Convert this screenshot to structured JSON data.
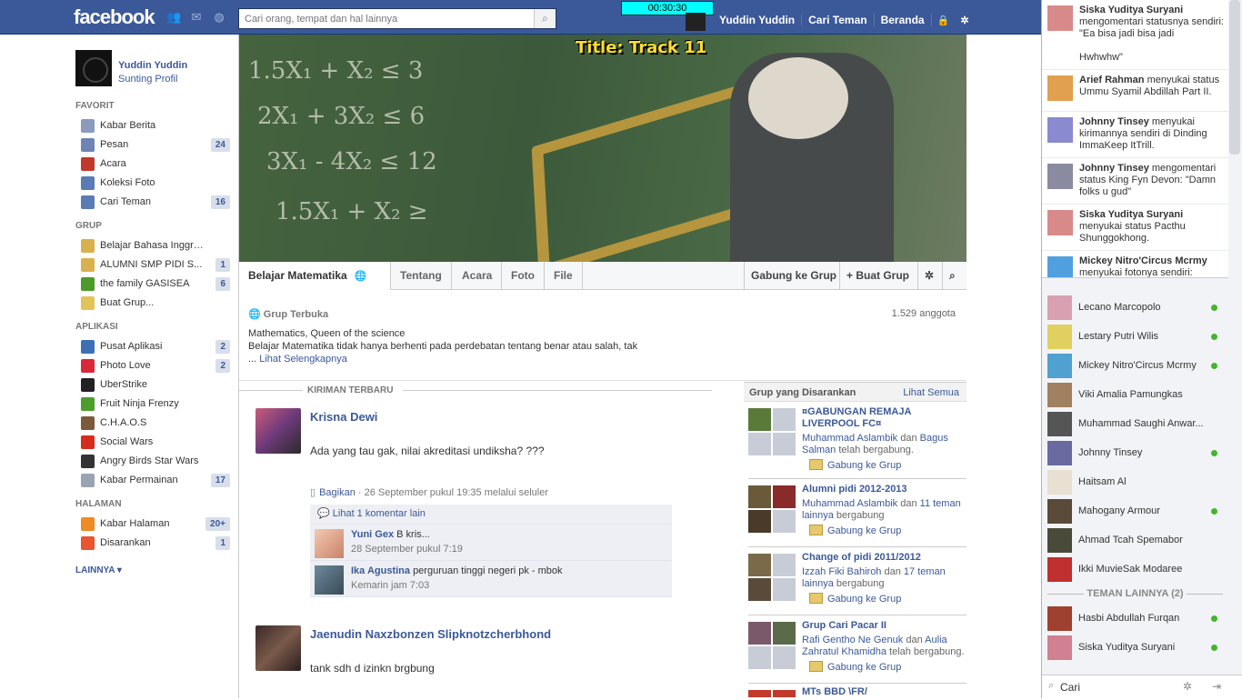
{
  "app": {
    "logo": "facebook",
    "search_placeholder": "Cari orang, tempat dan hal lainnya",
    "timer": "00:30:30"
  },
  "top": {
    "user": "Yuddin Yuddin",
    "find_friends": "Cari Teman",
    "home": "Beranda"
  },
  "profile": {
    "name": "Yuddin Yuddin",
    "edit": "Sunting Profil"
  },
  "nav": {
    "favorites_head": "FAVORIT",
    "favorites": [
      {
        "label": "Kabar Berita",
        "count": "",
        "icon": "news-feed-icon",
        "color": "#8a9bbd"
      },
      {
        "label": "Pesan",
        "count": "24",
        "icon": "messages-icon",
        "color": "#6d84b4"
      },
      {
        "label": "Acara",
        "count": "",
        "icon": "calendar-icon",
        "color": "#c0392b"
      },
      {
        "label": "Koleksi Foto",
        "count": "",
        "icon": "photos-icon",
        "color": "#5b7bb5"
      },
      {
        "label": "Cari Teman",
        "count": "16",
        "icon": "friends-icon",
        "color": "#5b7bb5"
      }
    ],
    "groups_head": "GRUP",
    "groups": [
      {
        "label": "Belajar Bahasa Inggris Bare...",
        "count": "",
        "icon": "group-icon",
        "color": "#d8b14c"
      },
      {
        "label": "ALUMNI SMP PIDI S...",
        "count": "1",
        "icon": "group-icon",
        "color": "#d8b14c"
      },
      {
        "label": "the family GASISEA",
        "count": "6",
        "icon": "tree-icon",
        "color": "#4c9a2a"
      },
      {
        "label": "Buat Grup...",
        "count": "",
        "icon": "create-group-icon",
        "color": "#e2c35a"
      }
    ],
    "apps_head": "APLIKASI",
    "apps": [
      {
        "label": "Pusat Aplikasi",
        "count": "2",
        "icon": "app-center-icon",
        "color": "#3d6fb6"
      },
      {
        "label": "Photo Love",
        "count": "2",
        "icon": "heart-icon",
        "color": "#d8283a"
      },
      {
        "label": "UberStrike",
        "count": "",
        "icon": "uberstrike-icon",
        "color": "#222222"
      },
      {
        "label": "Fruit Ninja Frenzy",
        "count": "",
        "icon": "watermelon-icon",
        "color": "#4b9e2c"
      },
      {
        "label": "C.H.A.O.S",
        "count": "",
        "icon": "chaos-icon",
        "color": "#7a5a3a"
      },
      {
        "label": "Social Wars",
        "count": "",
        "icon": "star-icon",
        "color": "#d62b1f"
      },
      {
        "label": "Angry Birds Star Wars",
        "count": "",
        "icon": "angry-birds-icon",
        "color": "#333333"
      },
      {
        "label": "Kabar Permainan",
        "count": "17",
        "icon": "games-icon",
        "color": "#9aa3b0"
      }
    ],
    "pages_head": "HALAMAN",
    "pages": [
      {
        "label": "Kabar Halaman",
        "count": "20+",
        "icon": "page-feed-icon",
        "color": "#f08a24"
      },
      {
        "label": "Disarankan",
        "count": "1",
        "icon": "suggested-icon",
        "color": "#e8552f"
      }
    ],
    "more": "LAINNYA"
  },
  "cover": {
    "title": "Title: Track 11"
  },
  "group": {
    "name": "Belajar Matematika",
    "tabs": [
      "Tentang",
      "Acara",
      "Foto",
      "File"
    ],
    "join": "Gabung ke Grup",
    "create": "+ Buat Grup",
    "type": "Grup Terbuka",
    "members": "1.529 anggota",
    "desc1": "Mathematics, Queen of the science",
    "desc2": "Belajar Matematika tidak hanya berhenti pada perdebatan tentang benar atau salah, tak",
    "desc3": "...",
    "see_more": "Lihat Selengkapnya"
  },
  "feed": {
    "head": "KIRIMAN TERBARU",
    "post1": {
      "author": "Krisna Dewi",
      "text": "Ada yang tau gak, nilai akreditasi undiksha? ???",
      "share": "Bagikan",
      "meta": "· 26 September pukul 19:35 melalui seluler",
      "more_comments": "Lihat 1 komentar lain",
      "comments": [
        {
          "name": "Yuni Gex",
          "text": "B kris...",
          "time": "28 September pukul 7:19"
        },
        {
          "name": "Ika Agustina",
          "text": "perguruan tinggi negeri pk - mbok",
          "time": "Kemarin jam 7:03"
        }
      ]
    },
    "post2": {
      "author": "Jaenudin Naxzbonzen Slipknotzcherbhond",
      "text": "tank sdh d izinkn brgbung"
    }
  },
  "suggested": {
    "head": "Grup yang Disarankan",
    "see_all": "Lihat Semua",
    "join": "Gabung ke Grup",
    "groups": [
      {
        "title": "¤GABUNGAN REMAJA LIVERPOOL FC¤",
        "n1": "Muhammad Aslambik",
        "mid": "dan",
        "n2": "Bagus Salman",
        "tail": "telah bergabung."
      },
      {
        "title": "Alumni pidi 2012-2013",
        "n1": "Muhammad Aslambik",
        "mid": "dan",
        "n2": "11 teman lainnya",
        "tail": "bergabung"
      },
      {
        "title": "Change of pidi 2011/2012",
        "n1": "Izzah Fiki Bahiroh",
        "mid": "dan",
        "n2": "17 teman lainnya",
        "tail": "bergabung"
      },
      {
        "title": "Grup Cari Pacar II",
        "n1": "Rafi Gentho Ne Genuk",
        "mid": "dan",
        "n2": "Aulia Zahratul Khamidha",
        "tail": "telah bergabung."
      }
    ],
    "partial": "MTs   BBD \\FR/"
  },
  "ticker": [
    {
      "name": "Siska Yuditya Suryani",
      "text": "mengomentari statusnya sendiri: \"Ea bisa jadi bisa jadi",
      "extra": "Hwhwhw\""
    },
    {
      "name": "Arief Rahman",
      "text": "menyukai status Ummu Syamil Abdillah Part II.",
      "extra": ""
    },
    {
      "name": "Johnny Tinsey",
      "text": "menyukai kirimannya sendiri di Dinding ImmaKeep ItTrill.",
      "extra": ""
    },
    {
      "name": "Johnny Tinsey",
      "text": "mengomentari status King Fyn Devon: \"Damn folks u gud\"",
      "extra": ""
    },
    {
      "name": "Siska Yuditya Suryani",
      "text": "menyukai status Pacthu Shunggokhong.",
      "extra": ""
    },
    {
      "name": "Mickey Nitro'Circus Mcrmy",
      "text": "menyukai fotonya sendiri:",
      "extra": ""
    }
  ],
  "chat": {
    "online": [
      {
        "name": "Lecano Marcopolo",
        "online": true
      },
      {
        "name": "Lestary Putri Wilis",
        "online": true
      },
      {
        "name": "Mickey Nitro'Circus Mcrmy",
        "online": true
      },
      {
        "name": "Viki Amalia Pamungkas",
        "online": false
      },
      {
        "name": "Muhammad Saughi Anwar...",
        "online": false
      },
      {
        "name": "Johnny Tinsey",
        "online": true
      },
      {
        "name": "Haitsam Al",
        "online": false
      },
      {
        "name": "Mahogany Armour",
        "online": true
      },
      {
        "name": "Ahmad Tcah Spemabor",
        "online": false
      },
      {
        "name": "Ikki MuvieSak Modaree",
        "online": false
      }
    ],
    "others_head": "TEMAN LAINNYA (2)",
    "others": [
      {
        "name": "Hasbi Abdullah Furqan",
        "online": true
      },
      {
        "name": "Siska Yuditya Suryani",
        "online": true
      }
    ],
    "search_value": "Cari"
  }
}
